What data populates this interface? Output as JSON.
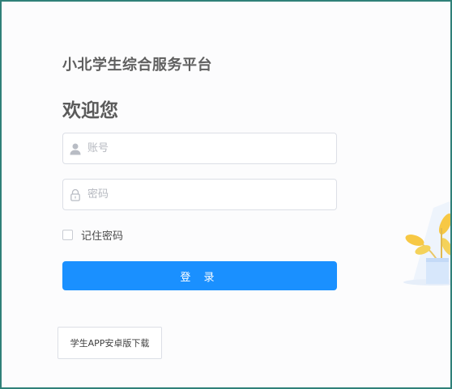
{
  "platform": {
    "title": "小北学生综合服务平台"
  },
  "login": {
    "welcome": "欢迎您",
    "username_placeholder": "账号",
    "password_placeholder": "密码",
    "remember_label": "记住密码",
    "submit_label": "登 录"
  },
  "download": {
    "label": "学生APP安卓版下载"
  },
  "colors": {
    "primary": "#1a90ff",
    "frame_border": "#2f8079",
    "title_text": "#5f5f5f"
  },
  "icons": {
    "username": "user-icon",
    "password": "lock-icon",
    "illustration": "potted-plant-illustration"
  }
}
